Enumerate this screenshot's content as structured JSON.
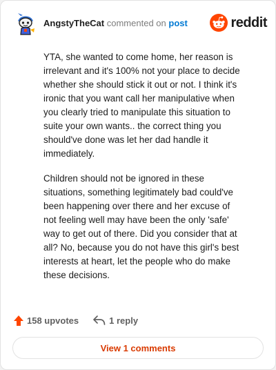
{
  "header": {
    "username": "AngstyTheCat",
    "commented_on": "commented on",
    "post_link": "post",
    "brand_wordmark": "reddit",
    "avatar_icon": "snoo-avatar-icon",
    "brand_icon": "reddit-alien-icon"
  },
  "comment": {
    "paragraphs": [
      "YTA, she wanted to come home, her reason is irrelevant and it's 100% not your place to decide whether she should stick it out or not. I think it's ironic that you want call her manipulative when you clearly tried to manipulate this situation to suite your own wants.. the correct thing you should've done was let her dad handle it immediately.",
      "Children should not be ignored in these situations, something legitimately bad could've been happening over there and her excuse of not feeling well may have been the only 'safe' way to get out of there. Did you consider that at all? No, because you do not have this girl's best interests at heart, let the people who do make these decisions."
    ]
  },
  "actions": {
    "upvotes_label": "158 upvotes",
    "reply_label": "1 reply",
    "upvote_icon": "upvote-arrow-icon",
    "reply_icon": "reply-arrow-icon"
  },
  "footer": {
    "view_comments_label": "View 1 comments"
  },
  "colors": {
    "brand_orange": "#ff4500",
    "upvote_orange": "#ff4500",
    "link_blue": "#0079d3",
    "button_text": "#d93a00",
    "text": "#1c1c1c",
    "muted": "#7c7c7c"
  }
}
